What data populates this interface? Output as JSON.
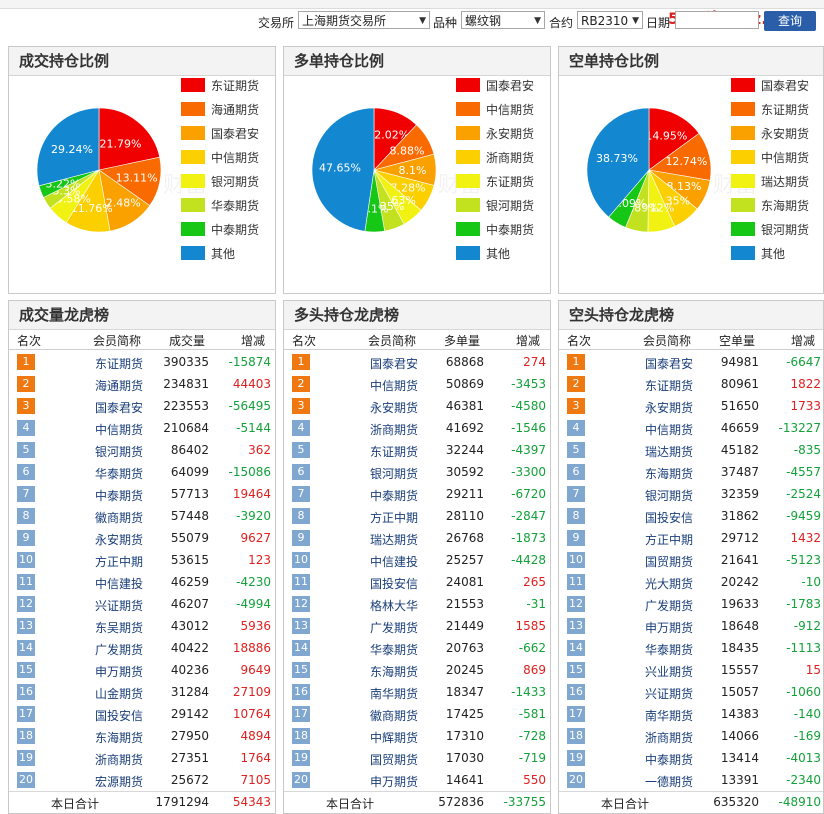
{
  "site_logo": "56天资5etz.com",
  "top_nav": [
    "",
    "",
    "",
    "",
    "",
    "",
    "",
    ""
  ],
  "filters": {
    "exchange_label": "交易所",
    "exchange_value": "上海期货交易所",
    "product_label": "品种",
    "product_value": "螺纹钢",
    "contract_label": "合约",
    "contract_value": "RB2310",
    "date_label": "日期",
    "date_value": "",
    "query_button": "查询"
  },
  "watermark": "东方财富",
  "colors": {
    "palette": [
      "#f00000",
      "#f96a00",
      "#faa100",
      "#fbcf00",
      "#f1f212",
      "#c2e21f",
      "#16c716",
      "#1387cf"
    ],
    "rank_top": "#f07810",
    "rank_other": "#7fa7cf",
    "positive": "#e02020",
    "negative": "#13a13a"
  },
  "pies": [
    {
      "title": "成交持仓比例",
      "legend": [
        "东证期货",
        "海通期货",
        "国泰君安",
        "中信期货",
        "银河期货",
        "华泰期货",
        "中泰期货",
        "其他"
      ],
      "values": [
        21.79,
        13.11,
        12.48,
        11.76,
        5.58,
        3.3,
        3.22,
        29.24
      ],
      "labels": [
        "21.79%",
        "13.11%",
        "12.48%",
        "11.76%",
        "5.58%",
        "3.3%",
        "3.22%",
        "29.24%"
      ]
    },
    {
      "title": "多单持仓比例",
      "legend": [
        "国泰君安",
        "中信期货",
        "永安期货",
        "浙商期货",
        "东证期货",
        "银河期货",
        "中泰期货",
        "其他"
      ],
      "values": [
        12.02,
        8.88,
        8.1,
        7.28,
        5.63,
        5.35,
        5.1,
        47.65
      ],
      "labels": [
        "12.02%",
        "8.88%",
        "8.1%",
        "7.28%",
        "5.63%",
        "5.35%",
        "5.1%",
        "47.65%"
      ]
    },
    {
      "title": "空单持仓比例",
      "legend": [
        "国泰君安",
        "东证期货",
        "永安期货",
        "中信期货",
        "瑞达期货",
        "东海期货",
        "银河期货",
        "其他"
      ],
      "values": [
        14.95,
        12.74,
        8.13,
        7.35,
        7.12,
        5.89,
        5.09,
        38.73
      ],
      "labels": [
        "14.95%",
        "12.74%",
        "8.13%",
        "7.35%",
        "7.12%",
        "5.89%",
        "5.09%",
        "38.73%"
      ]
    }
  ],
  "boards": [
    {
      "title": "成交量龙虎榜",
      "headers": [
        "名次",
        "会员简称",
        "成交量",
        "增减"
      ],
      "rows": [
        [
          "1",
          "东证期货",
          "390335",
          "-15874"
        ],
        [
          "2",
          "海通期货",
          "234831",
          "44403"
        ],
        [
          "3",
          "国泰君安",
          "223553",
          "-56495"
        ],
        [
          "4",
          "中信期货",
          "210684",
          "-5144"
        ],
        [
          "5",
          "银河期货",
          "86402",
          "362"
        ],
        [
          "6",
          "华泰期货",
          "64099",
          "-15086"
        ],
        [
          "7",
          "中泰期货",
          "57713",
          "19464"
        ],
        [
          "8",
          "徽商期货",
          "57448",
          "-3920"
        ],
        [
          "9",
          "永安期货",
          "55079",
          "9627"
        ],
        [
          "10",
          "方正中期",
          "53615",
          "123"
        ],
        [
          "11",
          "中信建投",
          "46259",
          "-4230"
        ],
        [
          "12",
          "兴证期货",
          "46207",
          "-4994"
        ],
        [
          "13",
          "东吴期货",
          "43012",
          "5936"
        ],
        [
          "14",
          "广发期货",
          "40422",
          "18886"
        ],
        [
          "15",
          "申万期货",
          "40236",
          "9649"
        ],
        [
          "16",
          "山金期货",
          "31284",
          "27109"
        ],
        [
          "17",
          "国投安信",
          "29142",
          "10764"
        ],
        [
          "18",
          "东海期货",
          "27950",
          "4894"
        ],
        [
          "19",
          "浙商期货",
          "27351",
          "1764"
        ],
        [
          "20",
          "宏源期货",
          "25672",
          "7105"
        ]
      ],
      "total_label": "本日合计",
      "total_value": "1791294",
      "total_change": "54343"
    },
    {
      "title": "多头持仓龙虎榜",
      "headers": [
        "名次",
        "会员简称",
        "多单量",
        "增减"
      ],
      "rows": [
        [
          "1",
          "国泰君安",
          "68868",
          "274"
        ],
        [
          "2",
          "中信期货",
          "50869",
          "-3453"
        ],
        [
          "3",
          "永安期货",
          "46381",
          "-4580"
        ],
        [
          "4",
          "浙商期货",
          "41692",
          "-1546"
        ],
        [
          "5",
          "东证期货",
          "32244",
          "-4397"
        ],
        [
          "6",
          "银河期货",
          "30592",
          "-3300"
        ],
        [
          "7",
          "中泰期货",
          "29211",
          "-6720"
        ],
        [
          "8",
          "方正中期",
          "28110",
          "-2847"
        ],
        [
          "9",
          "瑞达期货",
          "26768",
          "-1873"
        ],
        [
          "10",
          "中信建投",
          "25257",
          "-4428"
        ],
        [
          "11",
          "国投安信",
          "24081",
          "265"
        ],
        [
          "12",
          "格林大华",
          "21553",
          "-31"
        ],
        [
          "13",
          "广发期货",
          "21449",
          "1585"
        ],
        [
          "14",
          "华泰期货",
          "20763",
          "-662"
        ],
        [
          "15",
          "东海期货",
          "20245",
          "869"
        ],
        [
          "16",
          "南华期货",
          "18347",
          "-1433"
        ],
        [
          "17",
          "徽商期货",
          "17425",
          "-581"
        ],
        [
          "18",
          "中辉期货",
          "17310",
          "-728"
        ],
        [
          "19",
          "国贸期货",
          "17030",
          "-719"
        ],
        [
          "20",
          "申万期货",
          "14641",
          "550"
        ]
      ],
      "total_label": "本日合计",
      "total_value": "572836",
      "total_change": "-33755"
    },
    {
      "title": "空头持仓龙虎榜",
      "headers": [
        "名次",
        "会员简称",
        "空单量",
        "增减"
      ],
      "rows": [
        [
          "1",
          "国泰君安",
          "94981",
          "-6647"
        ],
        [
          "2",
          "东证期货",
          "80961",
          "1822"
        ],
        [
          "3",
          "永安期货",
          "51650",
          "1733"
        ],
        [
          "4",
          "中信期货",
          "46659",
          "-13227"
        ],
        [
          "5",
          "瑞达期货",
          "45182",
          "-835"
        ],
        [
          "6",
          "东海期货",
          "37487",
          "-4557"
        ],
        [
          "7",
          "银河期货",
          "32359",
          "-2524"
        ],
        [
          "8",
          "国投安信",
          "31862",
          "-9459"
        ],
        [
          "9",
          "方正中期",
          "29712",
          "1432"
        ],
        [
          "10",
          "国贸期货",
          "21641",
          "-5123"
        ],
        [
          "11",
          "光大期货",
          "20242",
          "-10"
        ],
        [
          "12",
          "广发期货",
          "19633",
          "-1783"
        ],
        [
          "13",
          "申万期货",
          "18648",
          "-912"
        ],
        [
          "14",
          "华泰期货",
          "18435",
          "-1113"
        ],
        [
          "15",
          "兴业期货",
          "15557",
          "15"
        ],
        [
          "16",
          "兴证期货",
          "15057",
          "-1060"
        ],
        [
          "17",
          "南华期货",
          "14383",
          "-140"
        ],
        [
          "18",
          "浙商期货",
          "14066",
          "-169"
        ],
        [
          "19",
          "中泰期货",
          "13414",
          "-4013"
        ],
        [
          "20",
          "一德期货",
          "13391",
          "-2340"
        ]
      ],
      "total_label": "本日合计",
      "total_value": "635320",
      "total_change": "-48910"
    }
  ]
}
